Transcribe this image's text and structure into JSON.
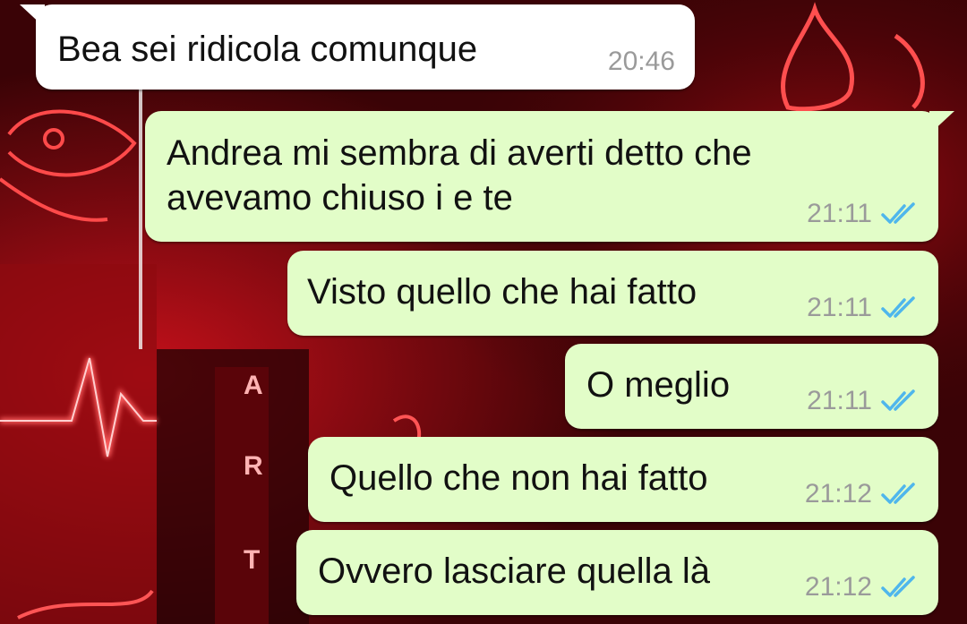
{
  "colors": {
    "incoming_bubble": "#ffffff",
    "outgoing_bubble": "#e2fdc8",
    "read_ticks": "#4fb6ec",
    "timestamp": "#9a9a9a",
    "wallpaper": "#3a0306",
    "neon": "#ff2a2a"
  },
  "wallpaper": {
    "description_icon": "neon-red-collage-wallpaper",
    "letters": [
      "A",
      "R",
      "T"
    ]
  },
  "messages": [
    {
      "direction": "incoming",
      "text": "Bea sei ridicola comunque",
      "time": "20:46",
      "status": ""
    },
    {
      "direction": "outgoing",
      "text": "Andrea mi sembra di averti detto che avevamo chiuso i e te",
      "time": "21:11",
      "status": "read"
    },
    {
      "direction": "outgoing",
      "text": "Visto quello che hai fatto",
      "time": "21:11",
      "status": "read"
    },
    {
      "direction": "outgoing",
      "text": "O meglio",
      "time": "21:11",
      "status": "read"
    },
    {
      "direction": "outgoing",
      "text": "Quello che non hai fatto",
      "time": "21:12",
      "status": "read"
    },
    {
      "direction": "outgoing",
      "text": "Ovvero lasciare quella là",
      "time": "21:12",
      "status": "read"
    }
  ]
}
